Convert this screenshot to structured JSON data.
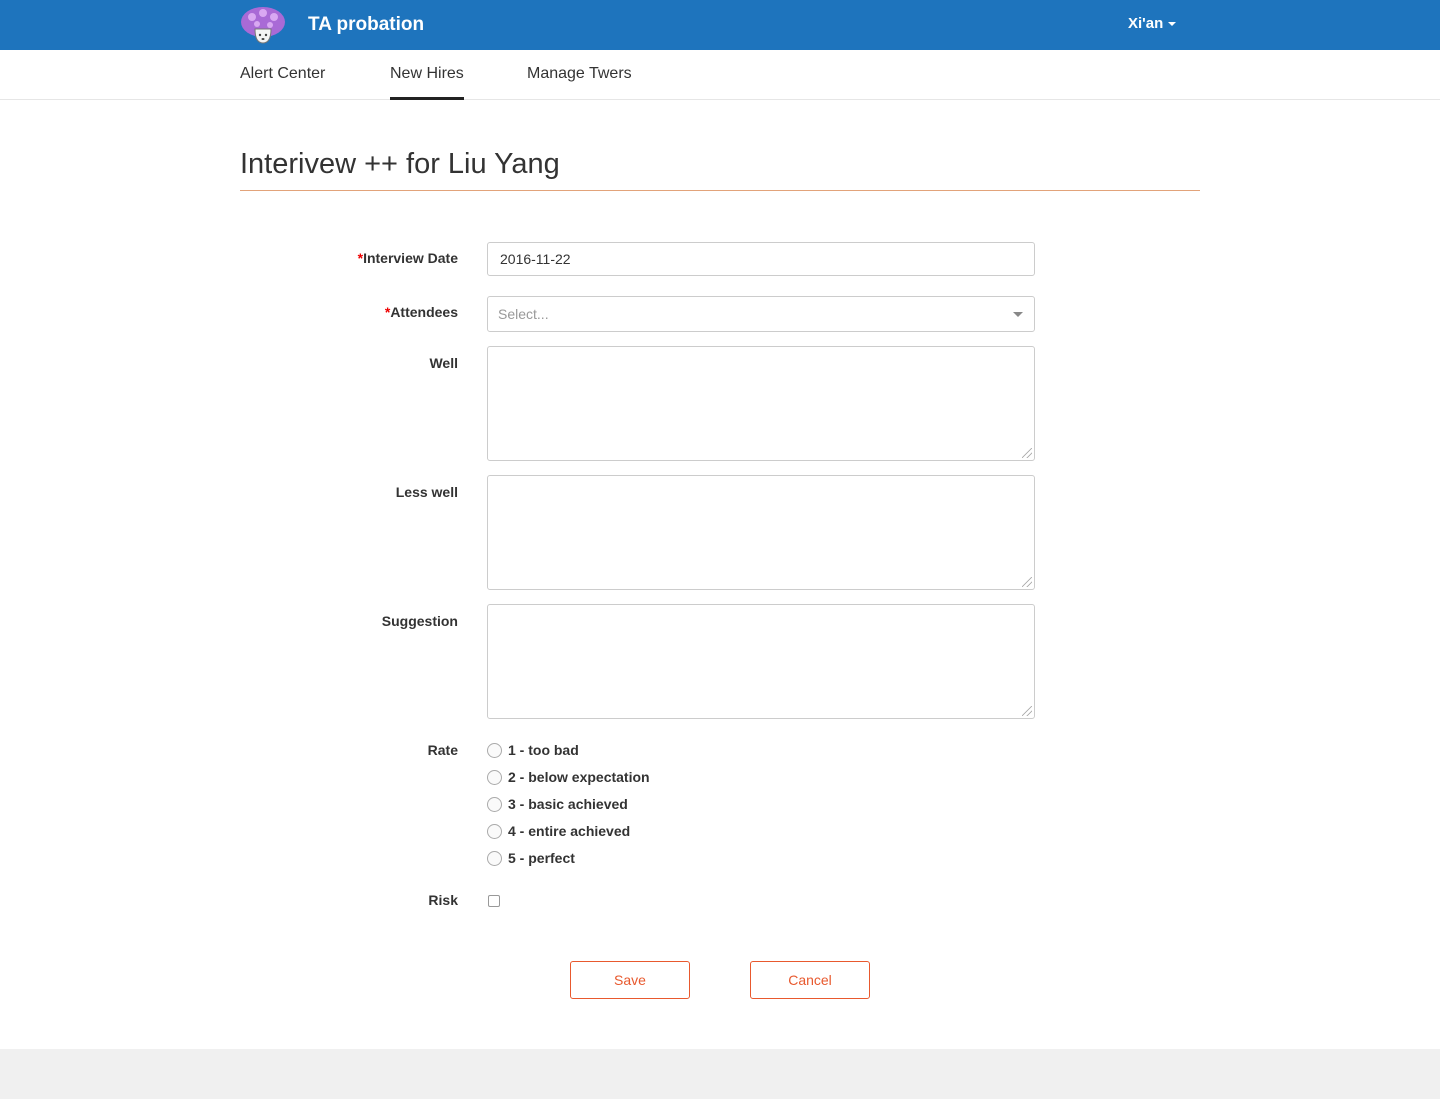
{
  "header": {
    "app_title": "TA probation",
    "user_name": "Xi'an",
    "logo_icon": "mushroom-logo-icon",
    "bar_color": "#1e74bd"
  },
  "nav": {
    "tabs": [
      {
        "label": "Alert Center",
        "active": false
      },
      {
        "label": "New Hires",
        "active": true
      },
      {
        "label": "Manage Twers",
        "active": false
      }
    ]
  },
  "page": {
    "title": "Interivew ++ for Liu Yang"
  },
  "form": {
    "required_marker": "*",
    "interview_date": {
      "label": "Interview Date",
      "value": "2016-11-22",
      "required": true
    },
    "attendees": {
      "label": "Attendees",
      "placeholder": "Select...",
      "required": true
    },
    "well": {
      "label": "Well",
      "value": ""
    },
    "less_well": {
      "label": "Less well",
      "value": ""
    },
    "suggestion": {
      "label": "Suggestion",
      "value": ""
    },
    "rate": {
      "label": "Rate",
      "options": [
        "1 - too bad",
        "2 - below expectation",
        "3 - basic achieved",
        "4 - entire achieved",
        "5 - perfect"
      ],
      "selected": null
    },
    "risk": {
      "label": "Risk",
      "checked": false
    },
    "buttons": {
      "save": "Save",
      "cancel": "Cancel"
    },
    "accent_color": "#e8592e"
  }
}
